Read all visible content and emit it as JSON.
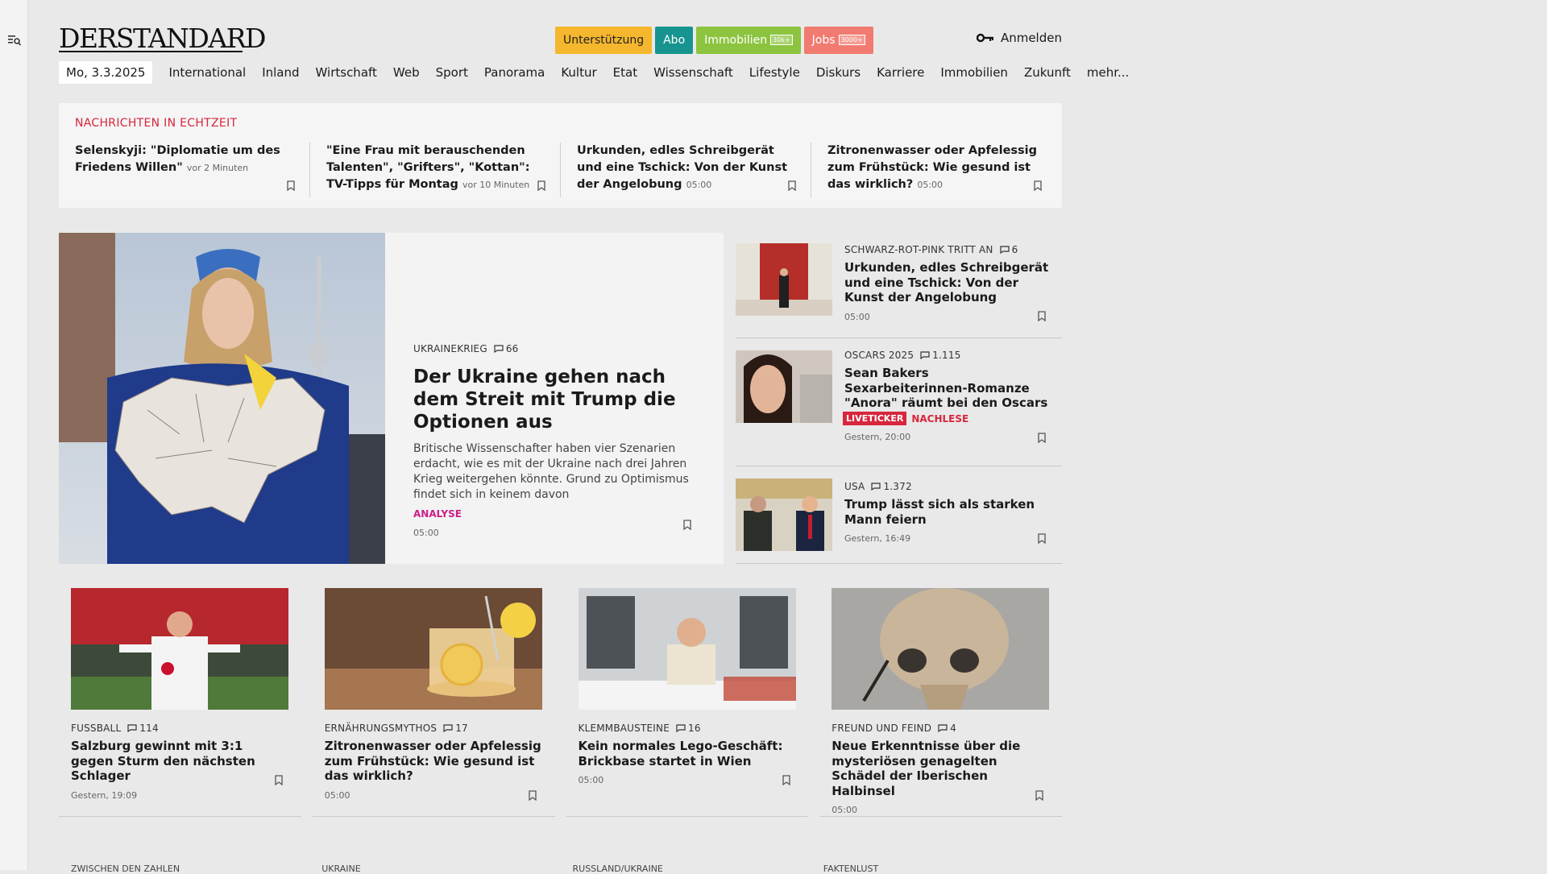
{
  "header": {
    "logo": "DERSTANDARD",
    "pills": [
      {
        "label": "Unterstützung",
        "tag": ""
      },
      {
        "label": "Abo",
        "tag": ""
      },
      {
        "label": "Immobilien",
        "tag": "30k+"
      },
      {
        "label": "Jobs",
        "tag": "3000+"
      }
    ],
    "login": "Anmelden"
  },
  "nav": {
    "date": "Mo, 3.3.2025",
    "items": [
      "International",
      "Inland",
      "Wirtschaft",
      "Web",
      "Sport",
      "Panorama",
      "Kultur",
      "Etat",
      "Wissenschaft",
      "Lifestyle",
      "Diskurs",
      "Karriere",
      "Immobilien",
      "Zukunft",
      "mehr..."
    ]
  },
  "ticker": {
    "title": "NACHRICHTEN IN ECHTZEIT",
    "items": [
      {
        "headline": "Selenskyji: \"Diplomatie um des Friedens Willen\"",
        "time": "vor 2 Minuten"
      },
      {
        "headline": "\"Eine Frau mit berauschenden Talenten\", \"Grifters\", \"Kottan\": TV-Tipps für Montag",
        "time": "vor 10 Minuten"
      },
      {
        "headline": "Urkunden, edles Schreibgerät und eine Tschick: Von der Kunst der Angelobung",
        "time": "05:00"
      },
      {
        "headline": "Zitronenwasser oder Apfelessig zum Frühstück: Wie gesund ist das wirklich?",
        "time": "05:00"
      }
    ]
  },
  "hero": {
    "kicker": "UKRAINEKRIEG",
    "comments": "66",
    "title": "Der Ukraine gehen nach dem Streit mit Trump die Optionen aus",
    "lead": "Britische Wissenschafter haben vier Szenarien erdacht, wie es mit der Ukraine nach drei Jahren Krieg weitergehen könnte. Grund zu Optimismus findet sich in keinem davon",
    "tag": "ANALYSE",
    "time": "05:00"
  },
  "side": [
    {
      "kicker": "SCHWARZ-ROT-PINK TRITT AN",
      "comments": "6",
      "title": "Urkunden, edles Schreibgerät und eine Tschick: Von der Kunst der Angelobung",
      "time": "05:00"
    },
    {
      "kicker": "OSCARS 2025",
      "comments": "1.115",
      "title": "Sean Bakers Sexarbeiterinnen-Romanze \"Anora\" räumt bei den Oscars ab",
      "live": "LIVETICKER",
      "nachlese": "NACHLESE",
      "time": "Gestern, 20:00"
    },
    {
      "kicker": "USA",
      "comments": "1.372",
      "title": "Trump lässt sich als starken Mann feiern",
      "time": "Gestern, 16:49"
    }
  ],
  "grid": [
    {
      "kicker": "FUSSBALL",
      "comments": "114",
      "title": "Salzburg gewinnt mit 3:1 gegen Sturm den nächsten Schlager",
      "time": "Gestern, 19:09"
    },
    {
      "kicker": "ERNÄHRUNGSMYTHOS",
      "comments": "17",
      "title": "Zitronenwasser oder Apfelessig zum Frühstück: Wie gesund ist das wirklich?",
      "time": "05:00"
    },
    {
      "kicker": "KLEMMBAUSTEINE",
      "comments": "16",
      "title": "Kein normales Lego-Geschäft: Brickbase startet in Wien",
      "time": "05:00"
    },
    {
      "kicker": "FREUND UND FEIND",
      "comments": "4",
      "title": "Neue Erkenntnisse über die mysteriösen genagelten Schädel der Iberischen Halbinsel",
      "time": "05:00"
    }
  ],
  "next_row": [
    "ZWISCHEN DEN ZAHLEN",
    "UKRAINE",
    "RUSSLAND/UKRAINE",
    "FAKTENLUST"
  ]
}
